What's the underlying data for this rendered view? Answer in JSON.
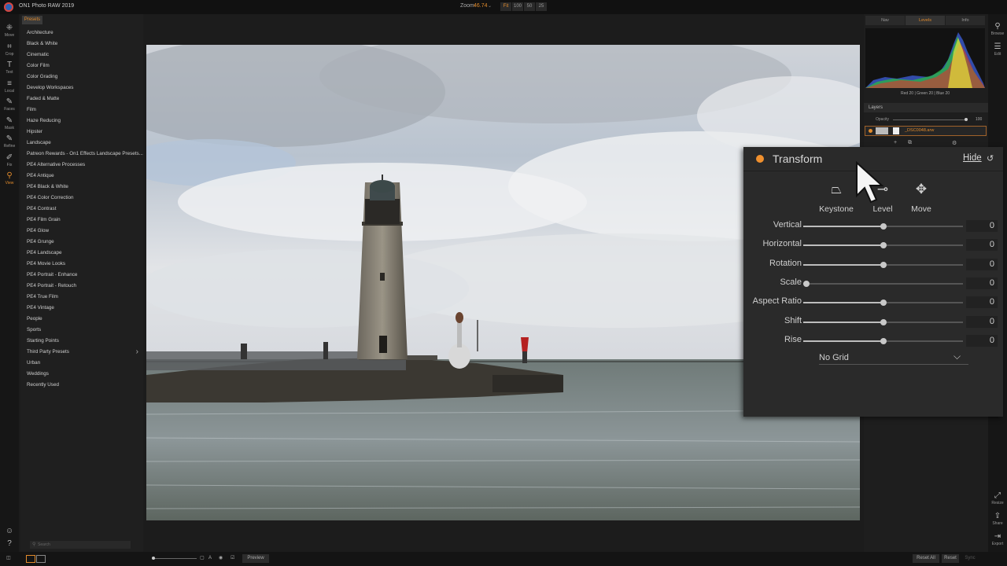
{
  "app": {
    "title": "ON1 Photo RAW 2019"
  },
  "zoom": {
    "label": "Zoom",
    "value": "46.74",
    "buttons": [
      "Fit",
      "100",
      "50",
      "25"
    ]
  },
  "tools": [
    {
      "label": "Move",
      "icon": "move-icon",
      "glyph": "⁜"
    },
    {
      "label": "Crop",
      "icon": "crop-icon",
      "glyph": "⌗"
    },
    {
      "label": "Text",
      "icon": "text-icon",
      "glyph": "T"
    },
    {
      "label": "Local",
      "icon": "local-icon",
      "glyph": "≡"
    },
    {
      "label": "Faces",
      "icon": "faces-icon",
      "glyph": "✎"
    },
    {
      "label": "Mask",
      "icon": "mask-icon",
      "glyph": "✎"
    },
    {
      "label": "Refine",
      "icon": "refine-icon",
      "glyph": "✎"
    },
    {
      "label": "Fix",
      "icon": "fix-icon",
      "glyph": "✐"
    },
    {
      "label": "View",
      "icon": "view-icon",
      "glyph": "⚲"
    }
  ],
  "presets": {
    "tab": "Presets",
    "items": [
      "Architecture",
      "Black & White",
      "Cinematic",
      "Color Film",
      "Color Grading",
      "Develop Workspaces",
      "Faded & Matte",
      "Film",
      "Haze Reducing",
      "Hipster",
      "Landscape",
      "Patreon Rewards - On1 Effects Landscape Presets...",
      "PE4 Alternative Processes",
      "PE4 Antique",
      "PE4 Black & White",
      "PE4 Color Correction",
      "PE4 Contrast",
      "PE4 Film Grain",
      "PE4 Glow",
      "PE4 Grunge",
      "PE4 Landscape",
      "PE4 Movie Looks",
      "PE4 Portrait - Enhance",
      "PE4 Portrait - Retouch",
      "PE4 True Film",
      "PE4 Vintage",
      "People",
      "Sports",
      "Starting Points",
      "Third Party Presets",
      "Urban",
      "Weddings",
      "Recently Used"
    ],
    "submenu_index": 29,
    "search_placeholder": "Search"
  },
  "right_tabs": [
    "Nav",
    "Levels",
    "Info"
  ],
  "histogram": {
    "readout": "Red 20 | Green 20 | Blue 20"
  },
  "layers": {
    "header": "Layers",
    "opacity_label": "Opacity",
    "opacity_value": "100",
    "layer_name": "_DSC0048.arw"
  },
  "right_strip": [
    {
      "label": "Browse",
      "icon": "browse-icon",
      "glyph": "⚲"
    },
    {
      "label": "Edit",
      "icon": "edit-icon",
      "glyph": "☰"
    }
  ],
  "right_strip_bottom": [
    {
      "label": "Resize",
      "icon": "resize-icon",
      "glyph": "⤢"
    },
    {
      "label": "Share",
      "icon": "share-icon",
      "glyph": "⇪"
    },
    {
      "label": "Export",
      "icon": "export-icon",
      "glyph": "⇥"
    }
  ],
  "transform": {
    "title": "Transform",
    "hide_label": "Hide",
    "modes": [
      {
        "label": "Keystone",
        "icon": "keystone-icon",
        "glyph": "⏢"
      },
      {
        "label": "Level",
        "icon": "level-icon",
        "glyph": "⊸"
      },
      {
        "label": "Move",
        "icon": "move-arrows-icon",
        "glyph": "✥"
      }
    ],
    "sliders": [
      {
        "label": "Vertical",
        "value": "0",
        "position": 0.5
      },
      {
        "label": "Horizontal",
        "value": "0",
        "position": 0.5
      },
      {
        "label": "Rotation",
        "value": "0",
        "position": 0.5
      },
      {
        "label": "Scale",
        "value": "0",
        "position": 0.02
      },
      {
        "label": "Aspect Ratio",
        "value": "0",
        "position": 0.5
      },
      {
        "label": "Shift",
        "value": "0",
        "position": 0.5
      },
      {
        "label": "Rise",
        "value": "0",
        "position": 0.5
      }
    ],
    "grid": "No Grid"
  },
  "bottom": {
    "preview": "Preview",
    "reset_all": "Reset All",
    "reset": "Reset",
    "sync": "Sync"
  },
  "colors": {
    "accent": "#e08a2c",
    "panel": "#2a2a2a"
  }
}
